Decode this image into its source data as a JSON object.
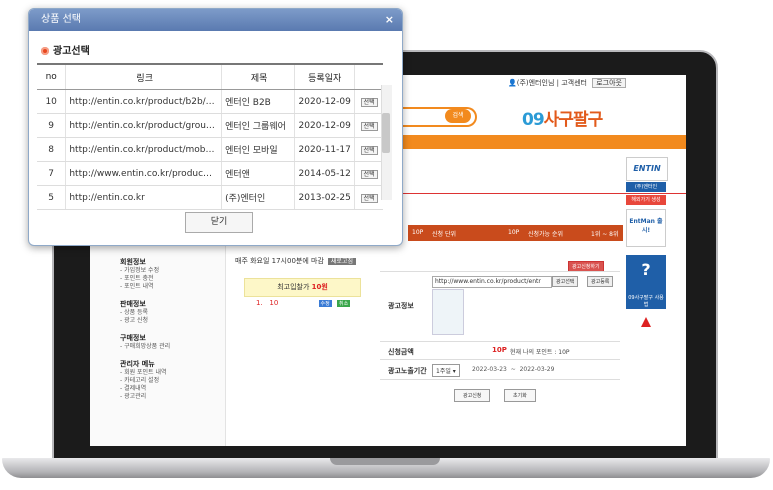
{
  "popup": {
    "title": "상품 선택",
    "close_glyph": "×",
    "section": "광고선택",
    "columns": [
      "no",
      "링크",
      "제목",
      "등록일자"
    ],
    "rows": [
      {
        "no": "10",
        "link": "http://entin.co.kr/product/b2b/…",
        "title": "엔터인 B2B",
        "date": "2020-12-09",
        "select": "선택"
      },
      {
        "no": "9",
        "link": "http://entin.co.kr/product/grou…",
        "title": "엔터인 그룹웨어",
        "date": "2020-12-09",
        "select": "선택"
      },
      {
        "no": "8",
        "link": "http://entin.co.kr/product/mob…",
        "title": "엔터인 모바일",
        "date": "2020-11-17",
        "select": "선택"
      },
      {
        "no": "7",
        "link": "http://www.entin.co.kr/produc…",
        "title": "엔터앤",
        "date": "2014-05-12",
        "select": "선택"
      },
      {
        "no": "5",
        "link": "http://entin.co.kr",
        "title": "(주)엔터인",
        "date": "2013-02-25",
        "select": "선택"
      }
    ],
    "close_button": "닫기"
  },
  "site": {
    "user": "(주)엔터인님",
    "service_center": "고객센터",
    "logout": "로그아웃",
    "search_button": "검색",
    "logo_num": "09",
    "logo_text": "사구팔구",
    "steps": [
      "10P",
      "신청 단위",
      "10P",
      "신청가능 순위",
      "1위 ~ 8위"
    ],
    "notice": "매주 화요일 17시00분에 마감",
    "notice_btn": "새로고침",
    "bid_label": "최고입찰가",
    "bid_value": "10원",
    "bid_row_rank": "1.",
    "bid_row_value": "10",
    "bid_row_btn1": "수정",
    "bid_row_btn2": "취소",
    "ad_info_label": "광고정보",
    "ad_url": "http://www.entin.co.kr/product/entr",
    "ad_select_btn": "광고선택",
    "ad_register_btn": "광고등록",
    "ad_guide_btn": "광고신청하기",
    "amount_label": "신청금액",
    "amount_value": "10P",
    "current_points": "현재 나의 포인트 : 10P",
    "period_label": "광고노출기간",
    "period_select": "1주일",
    "period_start": "2022-03-23",
    "period_tilde": "~",
    "period_end": "2022-03-29",
    "apply_btn": "광고신청",
    "reset_btn": "초기화",
    "nav": {
      "member_title": "회원정보",
      "member_items": [
        "- 가입정보 수정",
        "- 포인트 충전",
        "- 포인트 내역"
      ],
      "sale_title": "판매정보",
      "sale_items": [
        "- 상품 등록",
        "- 광고 신청"
      ],
      "buy_title": "구매정보",
      "buy_items": [
        "- 구매희망상품 관리"
      ],
      "admin_title": "관리자 메뉴",
      "admin_items": [
        "- 회원 포인트 내역",
        "- 카테고리 설정",
        "- 결제내역",
        "- 광고관리"
      ]
    },
    "side_ads": {
      "entin_logo": "ENTIN",
      "entin_label": "(주)엔터인",
      "entin_sub": "해외가기 생성",
      "entman": "EntMan 출시!",
      "help": "09사구팔구 사용법"
    }
  },
  "colors": {
    "accent": "#f28a1e",
    "title_bar": "#6a8abf",
    "step_bar": "#c94b1c"
  }
}
